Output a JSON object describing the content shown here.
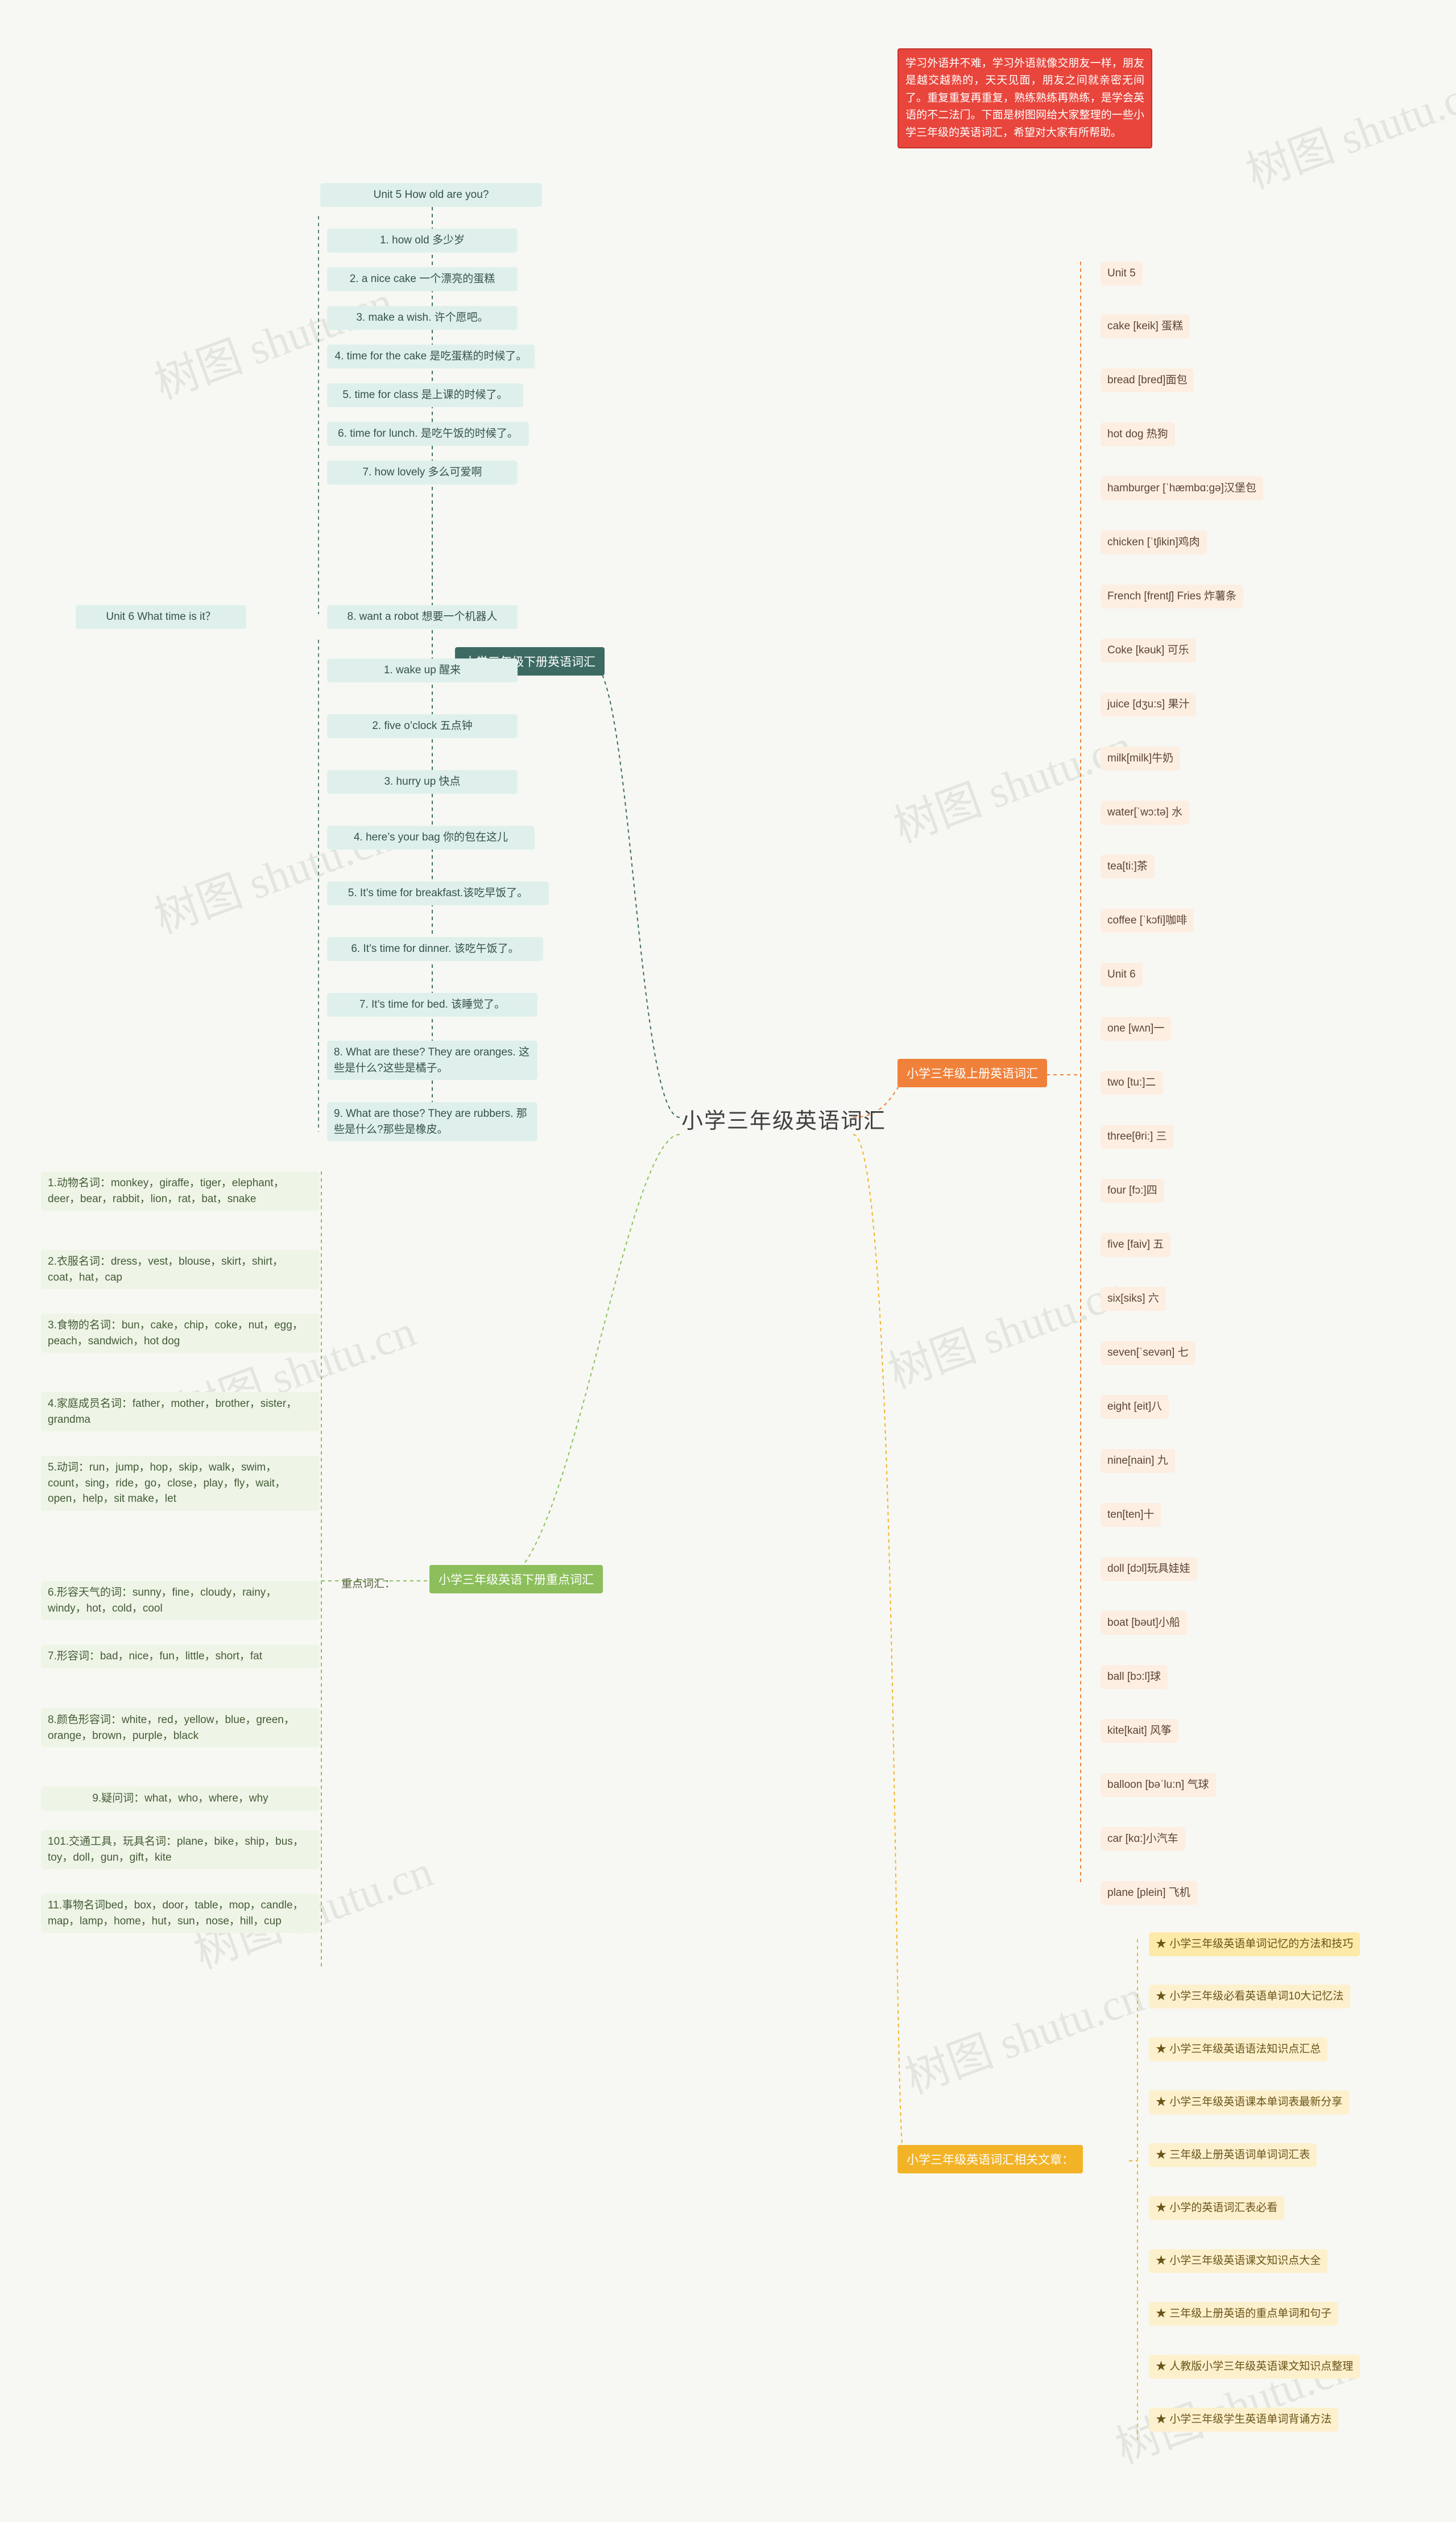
{
  "title": "小学三年级英语词汇",
  "watermarks": [
    "树图 shutu.cn",
    "树图 shutu.cn",
    "树图 shutu.cn",
    "树图 shutu.cn",
    "树图 shutu.cn",
    "树图 shutu.cn",
    "树图 shutu.cn",
    "树图 shutu.cn",
    "树图 shutu.cn"
  ],
  "red_note": "学习外语并不难，学习外语就像交朋友一样，朋友是越交越熟的，天天见面，朋友之间就亲密无间了。重复重复再重复，熟练熟练再熟练，是学会英语的不二法门。下面是树图网给大家整理的一些小学三年级的英语词汇，希望对大家有所帮助。",
  "branch_teal": {
    "label": "小学三年级下册英语词汇",
    "unit5_title": "Unit 5 How old are you?",
    "unit5_items": [
      "1. how old 多少岁",
      "2. a nice cake 一个漂亮的蛋糕",
      "3. make a wish. 许个愿吧。",
      "4. time for the cake 是吃蛋糕的时候了。",
      "5. time for class 是上课的时候了。",
      "6. time for lunch. 是吃午饭的时候了。",
      "7. how lovely 多么可爱啊",
      "8. want a robot 想要一个机器人"
    ],
    "unit6_title": "Unit 6 What time is it？",
    "unit6_items": [
      "1. wake up 醒来",
      "2. five o’clock 五点钟",
      "3. hurry up 快点",
      "4. here’s your bag 你的包在这儿",
      "5. It’s time for breakfast.该吃早饭了。",
      "6. It’s time for dinner. 该吃午饭了。",
      "7. It’s time for bed. 该睡觉了。",
      "8. What are these? They are oranges. 这些是什么?这些是橘子。",
      "9. What are those? They are rubbers. 那些是什么?那些是橡皮。"
    ]
  },
  "branch_peach": {
    "label": "小学三年级上册英语词汇",
    "unit5_title": "Unit 5",
    "unit5_items": [
      "cake [keik] 蛋糕",
      "bread [bred]面包",
      "hot dog 热狗",
      "hamburger [ˈhæmbɑ:gə]汉堡包",
      "chicken [ˈtʃikin]鸡肉",
      "French [frentʃ] Fries 炸薯条",
      "Coke [kəuk] 可乐",
      "juice [dʒu:s] 果汁",
      "milk[milk]牛奶",
      "water[ˈwɔ:tə] 水",
      "tea[ti:]茶",
      "coffee [ˈkɔfi]咖啡"
    ],
    "unit6_title": "Unit 6",
    "unit6_items": [
      "one [wʌn]一",
      "two [tu:]二",
      "three[θri:] 三",
      "four [fɔ:]四",
      "five [faiv] 五",
      "six[siks] 六",
      "seven[ˈsevən] 七",
      "eight [eit]八",
      "nine[nain] 九",
      "ten[ten]十",
      "doll [dɔl]玩具娃娃",
      "boat [bəut]小船",
      "ball [bɔ:l]球",
      "kite[kait] 风筝",
      "balloon [bəˈlu:n] 气球",
      "car [kɑ:]小汽车",
      "plane [plein] 飞机"
    ]
  },
  "branch_green": {
    "label": "小学三年级英语下册重点词汇",
    "sub_label": "重点词汇：",
    "items": [
      "1.动物名词：monkey，giraffe，tiger，elephant，deer，bear，rabbit，lion，rat，bat，snake",
      "2.衣服名词：dress，vest，blouse，skirt，shirt，coat，hat，cap",
      "3.食物的名词：bun，cake，chip，coke，nut，egg，peach，sandwich，hot dog",
      "4.家庭成员名词：father，mother，brother，sister，grandma",
      "5.动词：run，jump，hop，skip，walk，swim，count，sing，ride，go，close，play，fly，wait，open，help，sit make，let",
      "6.形容天气的词：sunny，fine，cloudy，rainy，windy，hot，cold，cool",
      "7.形容词：bad，nice，fun，little，short，fat",
      "8.颜色形容词：white，red，yellow，blue，green，orange，brown，purple，black",
      "9.疑问词：what，who，where，why",
      "101.交通工具，玩具名词：plane，bike，ship，bus，toy，doll，gun，gift，kite",
      "11.事物名词bed，box，door，table，mop，candle，map，lamp，home，hut，sun，nose，hill，cup"
    ]
  },
  "branch_yellow": {
    "label": "小学三年级英语词汇相关文章：",
    "items": [
      "★ 小学三年级英语单词记忆的方法和技巧",
      "★ 小学三年级必看英语单词10大记忆法",
      "★ 小学三年级英语语法知识点汇总",
      "★ 小学三年级英语课本单词表最新分享",
      "★ 三年级上册英语词单词词汇表",
      "★ 小学的英语词汇表必看",
      "★ 小学三年级英语课文知识点大全",
      "★ 三年级上册英语的重点单词和句子",
      "★ 人教版小学三年级英语课文知识点整理",
      "★ 小学三年级学生英语单词背诵方法"
    ]
  }
}
